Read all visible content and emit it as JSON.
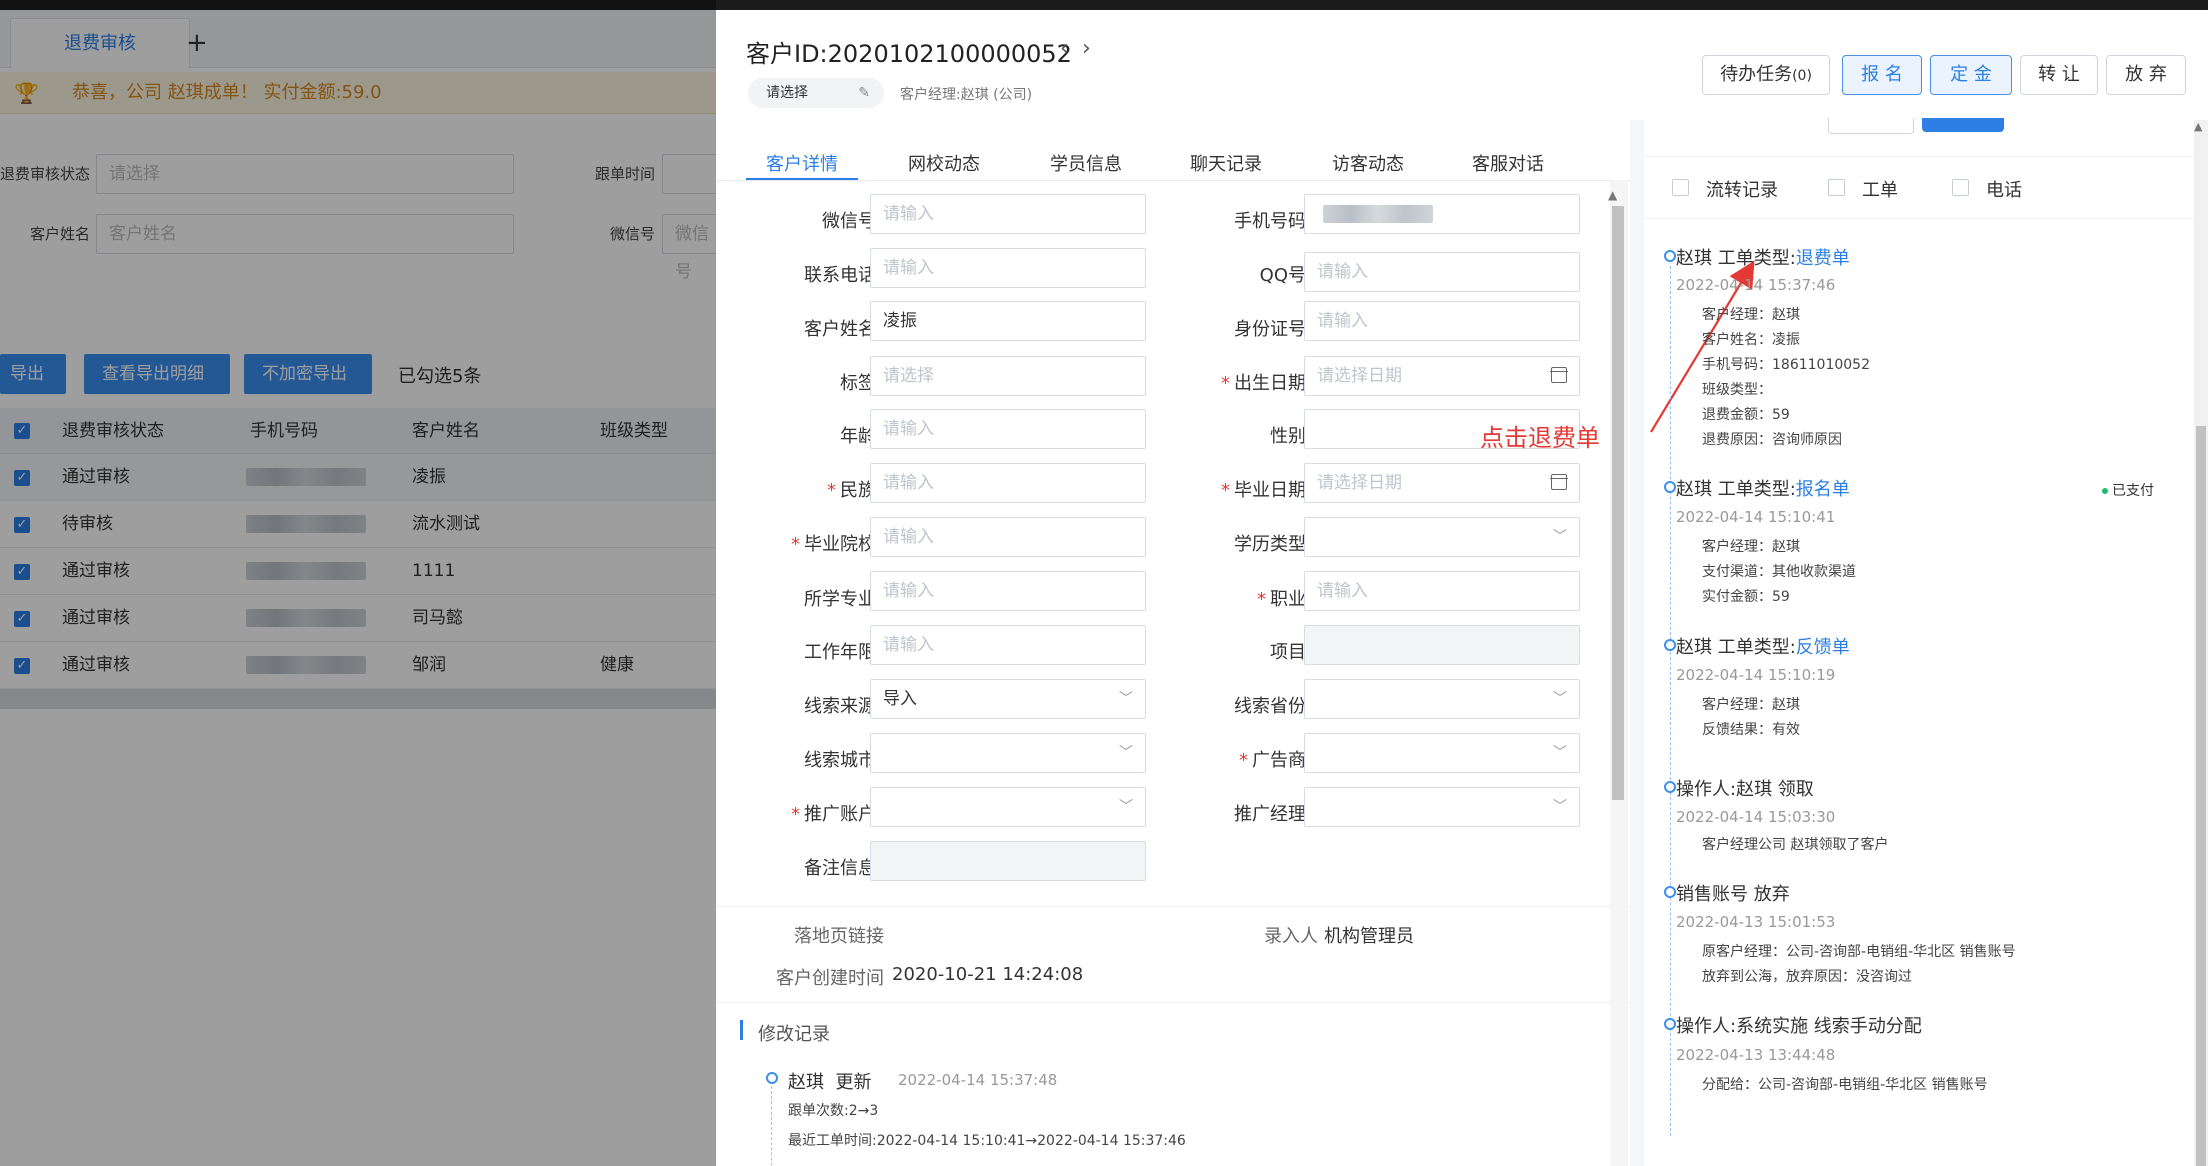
{
  "background": {
    "tab_label": "退费审核",
    "tab_add": "+",
    "notice": "恭喜，公司  赵琪成单！  实付金额:59.0",
    "filters": {
      "status_label": "退费审核状态",
      "status_placeholder": "请选择",
      "follow_time_label": "跟单时间",
      "name_label": "客户姓名",
      "name_placeholder": "客户姓名",
      "wechat_label": "微信号",
      "wechat_placeholder": "微信号"
    },
    "buttons": {
      "export": "导出",
      "view_export_detail": "查看导出明细",
      "export_no_encrypt": "不加密导出"
    },
    "selected_count": "已勾选5条",
    "table": {
      "headers": [
        "退费审核状态",
        "手机号码",
        "客户姓名",
        "班级类型"
      ],
      "rows": [
        {
          "status": "通过审核",
          "name": "凌振",
          "class": ""
        },
        {
          "status": "待审核",
          "name": "流水测试",
          "class": ""
        },
        {
          "status": "通过审核",
          "name": "1111",
          "class": ""
        },
        {
          "status": "通过审核",
          "name": "司马懿",
          "class": ""
        },
        {
          "status": "通过审核",
          "name": "邹润",
          "class": "健康"
        }
      ]
    }
  },
  "drawer": {
    "customer_id": "客户ID:2020102100000052",
    "select_placeholder": "请选择",
    "manager": "客户经理:赵琪 (公司)",
    "header_buttons": {
      "pending": "待办任务",
      "pending_count": "(0)",
      "enroll": "报 名",
      "deposit": "定 金",
      "transfer": "转 让",
      "give_up": "放 弃"
    },
    "tabs": [
      "客户详情",
      "网校动态",
      "学员信息",
      "聊天记录",
      "访客动态",
      "客服对话"
    ],
    "form": {
      "wechat": {
        "label": "微信号",
        "placeholder": "请输入"
      },
      "phone": {
        "label": "手机号码"
      },
      "contact": {
        "label": "联系电话",
        "placeholder": "请输入"
      },
      "qq": {
        "label": "QQ号",
        "placeholder": "请输入"
      },
      "name": {
        "label": "客户姓名",
        "value": "凌振"
      },
      "id_card": {
        "label": "身份证号",
        "placeholder": "请输入"
      },
      "tag": {
        "label": "标签",
        "placeholder": "请选择"
      },
      "birthday": {
        "label": "出生日期",
        "placeholder": "请选择日期"
      },
      "age": {
        "label": "年龄",
        "placeholder": "请输入"
      },
      "gender": {
        "label": "性别"
      },
      "ethnicity": {
        "label": "民族",
        "placeholder": "请输入"
      },
      "grad_date": {
        "label": "毕业日期",
        "placeholder": "请选择日期"
      },
      "school": {
        "label": "毕业院校",
        "placeholder": "请输入"
      },
      "edu_type": {
        "label": "学历类型"
      },
      "major": {
        "label": "所学专业",
        "placeholder": "请输入"
      },
      "job": {
        "label": "职业",
        "placeholder": "请输入"
      },
      "work_years": {
        "label": "工作年限",
        "placeholder": "请输入"
      },
      "project": {
        "label": "项目"
      },
      "lead_source": {
        "label": "线索来源",
        "value": "导入"
      },
      "lead_province": {
        "label": "线索省份"
      },
      "lead_city": {
        "label": "线索城市"
      },
      "advertiser": {
        "label": "广告商"
      },
      "promo_account": {
        "label": "推广账户"
      },
      "promo_manager": {
        "label": "推广经理"
      },
      "remark": {
        "label": "备注信息"
      }
    },
    "landing_link_label": "落地页链接",
    "entered_by_label": "录入人",
    "entered_by": "机构管理员",
    "created_label": "客户创建时间",
    "created_time": "2020-10-21 14:24:08",
    "annotation": "点击退费单",
    "history": {
      "title": "修改记录",
      "user": "赵琪",
      "action": "更新",
      "time": "2022-04-14 15:37:48",
      "line1": "跟单次数:2→3",
      "line2": "最近工单时间:2022-04-14 15:10:41→2022-04-14 15:37:46"
    },
    "filters_right": [
      "流转记录",
      "工单",
      "电话"
    ],
    "timeline": [
      {
        "title": "赵琪 工单类型:",
        "link": "退费单",
        "time": "2022-04-14 15:37:46",
        "lines": [
          "客户经理：赵琪",
          "客户姓名：凌振",
          "手机号码：18611010052",
          "班级类型：",
          "退费金额：59",
          "退费原因：咨询师原因"
        ]
      },
      {
        "title": "赵琪 工单类型:",
        "link": "报名单",
        "badge": "已支付",
        "time": "2022-04-14 15:10:41",
        "lines": [
          "客户经理：赵琪",
          "支付渠道：其他收款渠道",
          "实付金额：59"
        ]
      },
      {
        "title": "赵琪 工单类型:",
        "link": "反馈单",
        "time": "2022-04-14 15:10:19",
        "lines": [
          "客户经理：赵琪",
          "反馈结果：有效"
        ]
      },
      {
        "title": "操作人:赵琪 领取",
        "time": "2022-04-14 15:03:30",
        "lines": [
          "客户经理公司 赵琪领取了客户"
        ]
      },
      {
        "title": "销售账号 放弃",
        "time": "2022-04-13 15:01:53",
        "lines": [
          "原客户经理：公司-咨询部-电销组-华北区 销售账号",
          "放弃到公海，放弃原因：没咨询过"
        ]
      },
      {
        "title": "操作人:系统实施 线索手动分配",
        "time": "2022-04-13 13:44:48",
        "lines": [
          "分配给：公司-咨询部-电销组-华北区 销售账号"
        ]
      }
    ]
  },
  "colors": {
    "accent": "#2d7fe6",
    "required": "#e53935",
    "annotation": "#e53935",
    "paid": "#19be6b"
  }
}
